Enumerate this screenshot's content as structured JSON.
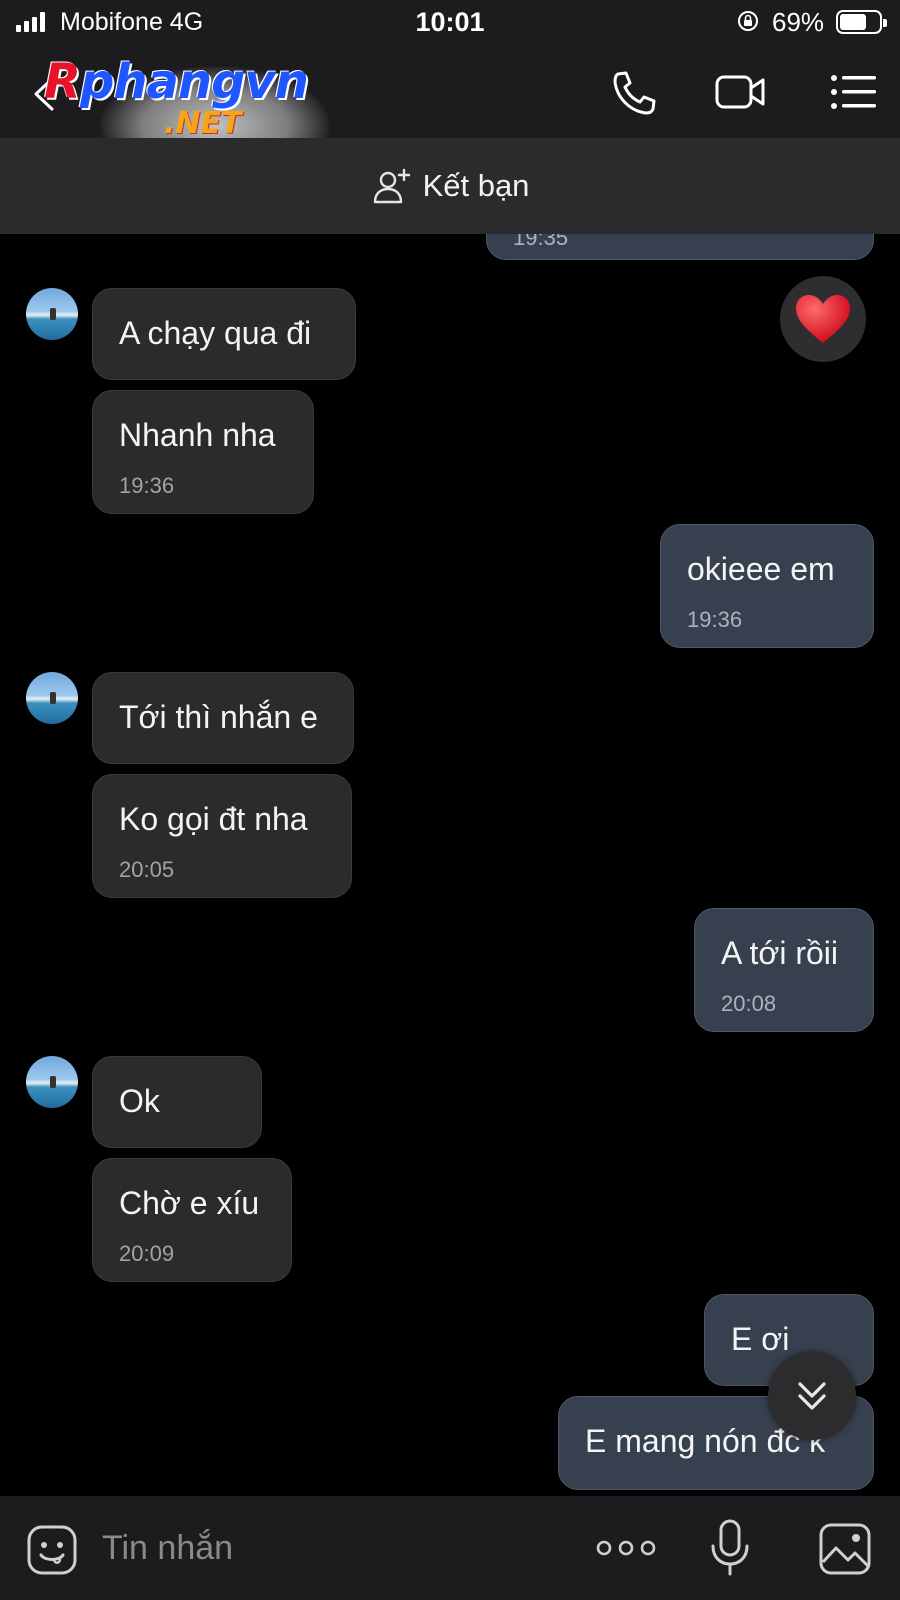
{
  "status_bar": {
    "carrier": "Mobifone 4G",
    "time": "10:01",
    "battery": "69%",
    "battery_level": 0.69
  },
  "header": {
    "logo_main": "Rphangvn",
    "logo_sub": ".NET"
  },
  "add_friend": {
    "label": "Kết bạn"
  },
  "messages": [
    {
      "side": "out",
      "text": "",
      "time": "19:35"
    },
    {
      "side": "in",
      "text": "A chạy qua đi",
      "time": ""
    },
    {
      "side": "in",
      "text": "Nhanh nha",
      "time": "19:36"
    },
    {
      "side": "out",
      "text": "okieee em",
      "time": "19:36"
    },
    {
      "side": "in",
      "text": "Tới thì nhắn e",
      "time": ""
    },
    {
      "side": "in",
      "text": "Ko gọi đt nha",
      "time": "20:05"
    },
    {
      "side": "out",
      "text": "A tới rồii",
      "time": "20:08"
    },
    {
      "side": "in",
      "text": "Ok",
      "time": ""
    },
    {
      "side": "in",
      "text": "Chờ e xíu",
      "time": "20:09"
    },
    {
      "side": "out",
      "text": "E ơi",
      "time": ""
    },
    {
      "side": "out",
      "text": "E mang nón đc k",
      "time": ""
    }
  ],
  "reaction": "heart-emoji",
  "input": {
    "placeholder": "Tin nhắn"
  },
  "icons": {
    "back": "chevron-left-icon",
    "call": "phone-icon",
    "video": "video-camera-icon",
    "menu": "list-menu-icon",
    "add_friend": "add-person-icon",
    "scroll_down": "double-chevron-down-icon",
    "sticker": "sticker-face-icon",
    "more": "more-dots-icon",
    "mic": "microphone-icon",
    "image": "image-icon"
  },
  "colors": {
    "background": "#000000",
    "bar": "#1c1c1e",
    "incoming_bubble": "#2b2b2d",
    "outgoing_bubble": "#37404e",
    "heart": "#e8132a"
  }
}
